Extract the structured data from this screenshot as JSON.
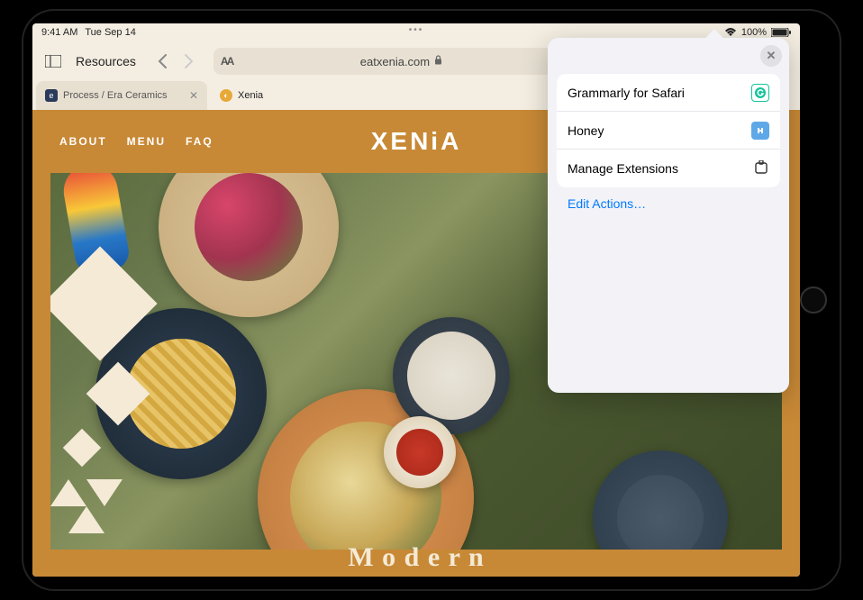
{
  "status": {
    "time": "9:41 AM",
    "date": "Tue Sep 14",
    "battery": "100%"
  },
  "toolbar": {
    "sidebar_label": "Resources",
    "text_size_label": "AA",
    "url": "eatxenia.com"
  },
  "tabs": [
    {
      "label": "Process / Era Ceramics",
      "active": false
    },
    {
      "label": "Xenia",
      "active": true
    }
  ],
  "site": {
    "nav": [
      "ABOUT",
      "MENU",
      "FAQ"
    ],
    "logo": "XENiA",
    "hero_tagline_partial": "M o d e r n"
  },
  "popover": {
    "items": [
      {
        "label": "Grammarly for Safari",
        "icon": "grammarly"
      },
      {
        "label": "Honey",
        "icon": "honey"
      }
    ],
    "manage_label": "Manage Extensions",
    "edit_label": "Edit Actions…"
  }
}
